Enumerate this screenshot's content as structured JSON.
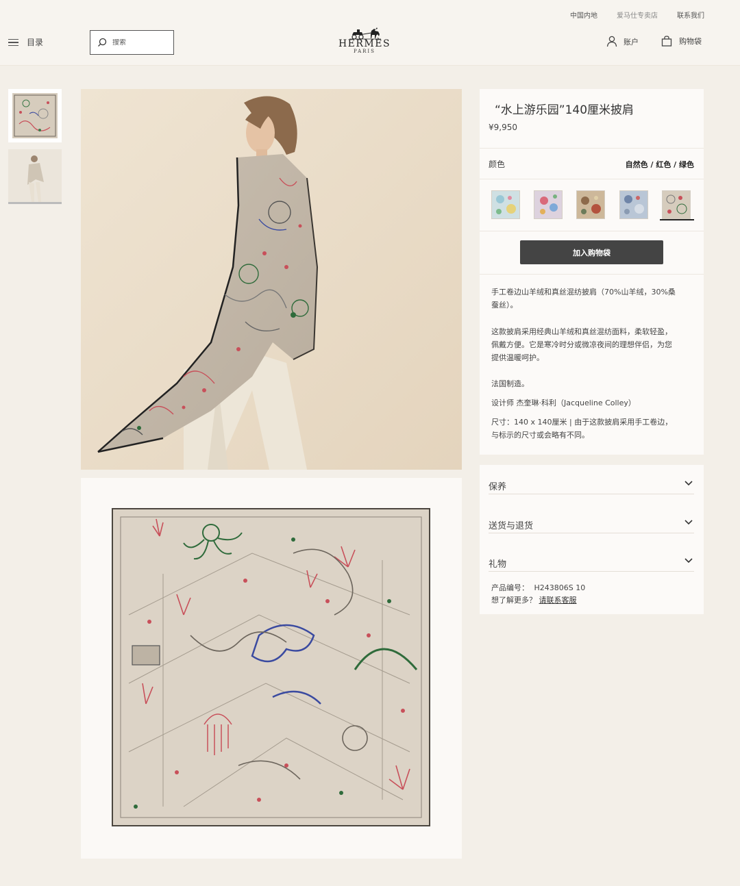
{
  "utility": {
    "region": "中国内地",
    "store": "爱马仕专卖店",
    "contact": "联系我们"
  },
  "header": {
    "menu_label": "目录",
    "search_placeholder": "搜索",
    "logo_name": "HERMÈS",
    "logo_sub": "PARIS",
    "account_label": "账户",
    "bag_label": "购物袋"
  },
  "product": {
    "title": "“水上游乐园”140厘米披肩",
    "price": "¥9,950",
    "color_label": "颜色",
    "color_value": "自然色 / 红色 / 绿色",
    "swatches": [
      "swatch-1",
      "swatch-2",
      "swatch-3",
      "swatch-4",
      "swatch-5"
    ],
    "selected_swatch_index": 4,
    "add_to_bag": "加入购物袋",
    "desc_line1a": "手工卷边山羊绒和真丝混纺披肩（70%山羊绒，30%桑",
    "desc_line1b": "蚕丝）。",
    "desc_line2a": "这款披肩采用经典山羊绒和真丝混纺面料，柔软轻盈，",
    "desc_line2b": "佩戴方便。它是寒冷时分或微凉夜间的理想伴侣，为您",
    "desc_line2c": "提供温暖呵护。",
    "made_in": "法国制造。",
    "designer": "设计师 杰奎琳·科利（Jacqueline Colley）",
    "size_a": "尺寸：140 x 140厘米 | 由于这款披肩采用手工卷边，",
    "size_b": "与标示的尺寸或会略有不同。"
  },
  "accordion": {
    "items": [
      {
        "label": "保养"
      },
      {
        "label": "送货与退货"
      },
      {
        "label": "礼物"
      }
    ],
    "ref_label": "产品编号：",
    "ref_value": "H243806S 10",
    "more_label": "想了解更多？",
    "more_link": "请联系客服"
  },
  "colors": {
    "page_bg": "#f3efe8",
    "button_bg": "#444444",
    "scarf_base": "#d9cfc1",
    "scarf_red": "#c8505a",
    "scarf_green": "#2f6b3b",
    "scarf_blue": "#3a4aa0"
  }
}
